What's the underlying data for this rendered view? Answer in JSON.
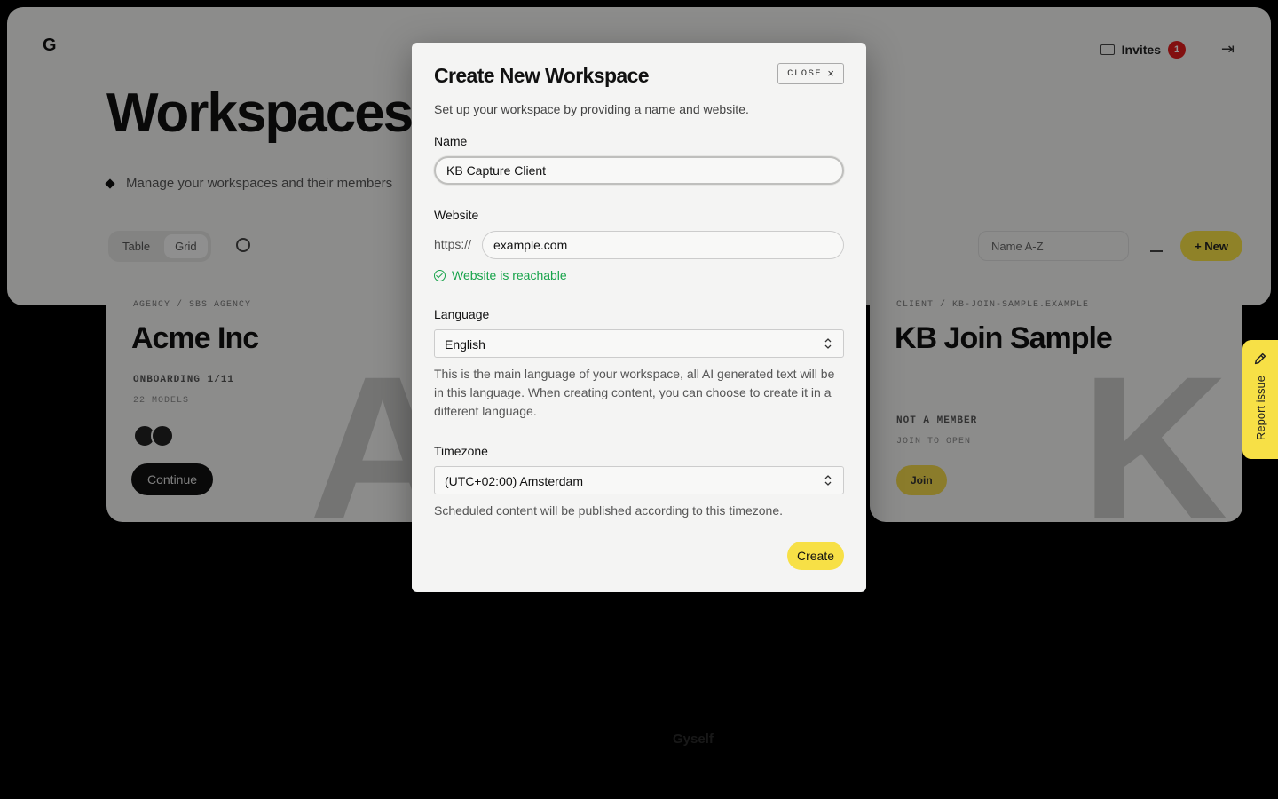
{
  "background": {
    "brand_logo": "G",
    "invites_label": "Invites",
    "invites_count": "1",
    "page_title": "Workspaces",
    "page_subtitle": "Manage your workspaces and their members",
    "view_tabs": [
      "Table",
      "Grid"
    ],
    "sort_value": "Name A-Z",
    "new_button": "+ New",
    "cards": [
      {
        "crumb": "AGENCY / SBS AGENCY",
        "name": "Acme Inc",
        "meta1": "ONBOARDING 1/11",
        "meta2": "22 MODELS",
        "letter": "A",
        "action": "Continue"
      },
      {
        "crumb": "CLIENT / KB-JOIN-SAMPLE.EXAMPLE",
        "name": "KB Join Sample",
        "meta1": "NOT A MEMBER",
        "meta2": "JOIN TO OPEN",
        "letter": "K",
        "action": "Join"
      }
    ],
    "footer_brand": "Gyself",
    "report_issue": "Report issue"
  },
  "modal": {
    "title": "Create New Workspace",
    "close_label": "CLOSE",
    "close_icon": "×",
    "subtitle": "Set up your workspace by providing a name and website.",
    "name_label": "Name",
    "name_value": "KB Capture Client",
    "website_label": "Website",
    "website_prefix": "https://",
    "website_value": "example.com",
    "website_status": "Website is reachable",
    "language_label": "Language",
    "language_value": "English",
    "language_help": "This is the main language of your workspace, all AI generated text will be in this language. When creating content, you can choose to create it in a different language.",
    "timezone_label": "Timezone",
    "timezone_value": "(UTC+02:00) Amsterdam",
    "timezone_help": "Scheduled content will be published according to this timezone.",
    "create_button": "Create"
  },
  "colors": {
    "accent_yellow": "#f7e046",
    "success_green": "#17a34a",
    "badge_red": "#e11d1d"
  }
}
